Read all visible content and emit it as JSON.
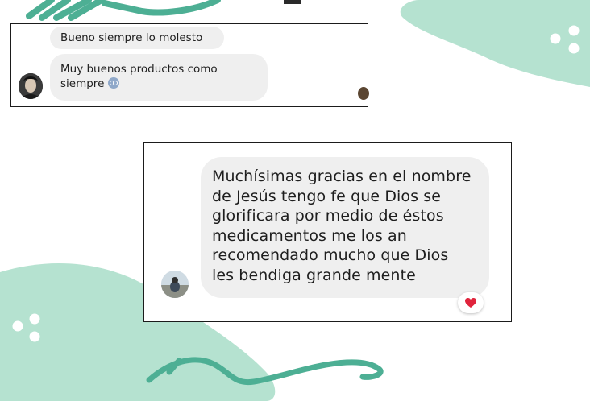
{
  "colors": {
    "accent_green": "#51b398",
    "light_green": "#b5e2d0",
    "bubble_gray": "#efefef",
    "heart_red": "#e0243c"
  },
  "chat1": {
    "messages": [
      {
        "text": "Bueno siempre lo molesto"
      },
      {
        "lines": [
          "Muy buenos productos como",
          "siempre"
        ],
        "emoji_icon": "sunglasses-emoji-icon"
      }
    ]
  },
  "chat2": {
    "message": {
      "lines": [
        "Muchísimas gracias en el nombre",
        "de Jesús tengo fe que Dios se",
        "glorificara por medio de éstos",
        "medicamentos me los an",
        "recomendado mucho que Dios",
        "les bendiga grande mente"
      ]
    },
    "reaction_icon": "heart-icon"
  }
}
